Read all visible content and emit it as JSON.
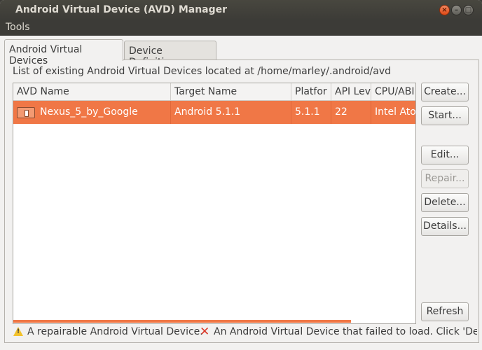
{
  "window": {
    "title": "Android Virtual Device (AVD) Manager",
    "controls": {
      "close": "×",
      "minimize": "–",
      "maximize": "□"
    }
  },
  "menu": {
    "tools": "Tools"
  },
  "tabs": [
    {
      "label": "Android Virtual Devices",
      "active": true
    },
    {
      "label": "Device Definitions",
      "active": false
    }
  ],
  "list": {
    "caption": "List of existing Android Virtual Devices located at /home/marley/.android/avd",
    "columns": [
      "AVD Name",
      "Target Name",
      "Platfor",
      "API Lev",
      "CPU/ABI"
    ],
    "rows": [
      {
        "name": "Nexus_5_by_Google",
        "target": "Android 5.1.1",
        "platform": "5.1.1",
        "api": "22",
        "cpu": "Intel Ato",
        "selected": true
      }
    ]
  },
  "buttons": {
    "create": "Create...",
    "start": "Start...",
    "edit": "Edit...",
    "repair": "Repair...",
    "delete": "Delete...",
    "details": "Details...",
    "refresh": "Refresh"
  },
  "legend": {
    "warning_text": "A repairable Android Virtual Device.",
    "error_text": "An Android Virtual Device that failed to load. Click 'Det"
  },
  "colors": {
    "selection": "#f07746",
    "titlebar": "#3c3b37",
    "warning": "#f3c22b",
    "error": "#d93a2b"
  },
  "icons": {
    "device": "device-icon",
    "warning": "warning-icon",
    "error": "error-icon"
  }
}
